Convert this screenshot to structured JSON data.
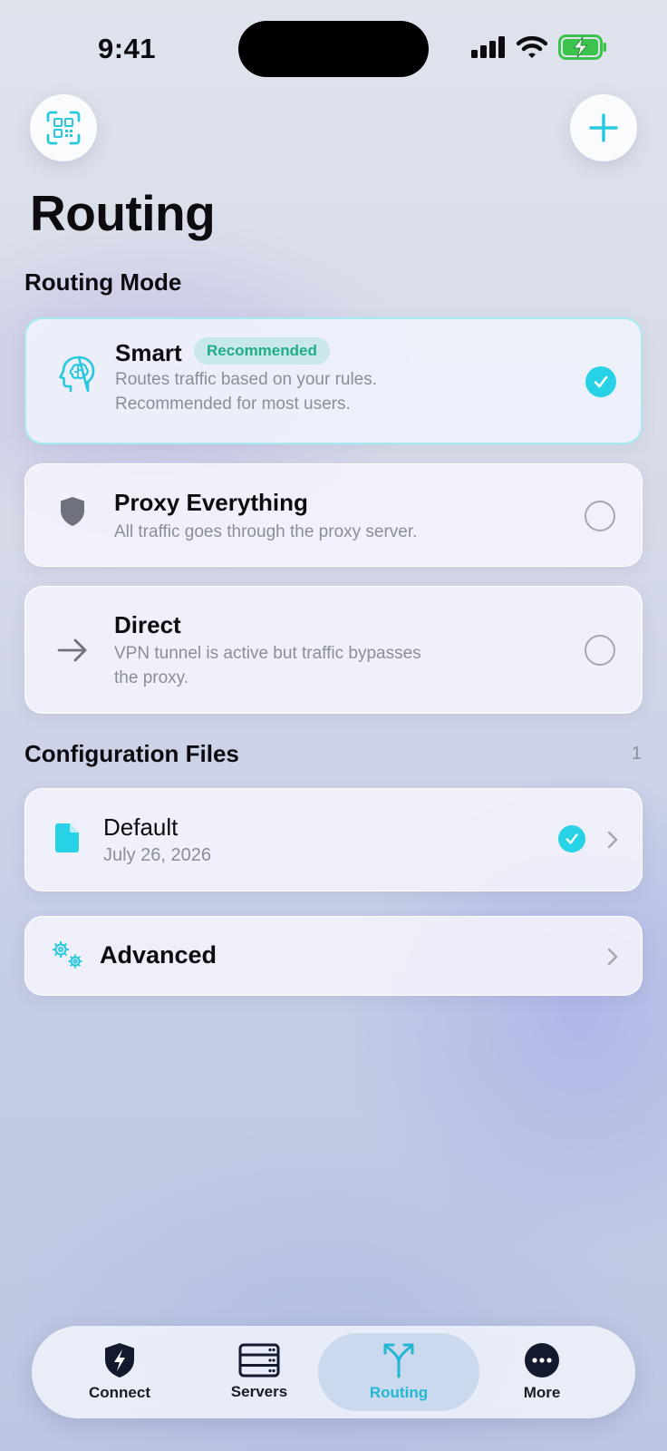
{
  "status_bar": {
    "time": "9:41"
  },
  "header": {
    "title": "Routing"
  },
  "routing_mode": {
    "section_title": "Routing Mode",
    "options": [
      {
        "name": "Smart",
        "badge": "Recommended",
        "description_line1": "Routes traffic based on your rules.",
        "description_line2": "Recommended for most users.",
        "selected": true,
        "icon": "brain-icon"
      },
      {
        "name": "Proxy Everything",
        "description_line1": "All traffic goes through the proxy server.",
        "selected": false,
        "icon": "shield-icon"
      },
      {
        "name": "Direct",
        "description_line1": "VPN tunnel is active but traffic bypasses",
        "description_line2": "the proxy.",
        "selected": false,
        "icon": "arrow-right-icon"
      }
    ]
  },
  "configuration_files": {
    "section_title": "Configuration Files",
    "count": "1",
    "files": [
      {
        "name": "Default",
        "date": "July 26, 2026",
        "selected": true,
        "icon": "document-icon"
      }
    ]
  },
  "advanced": {
    "label": "Advanced",
    "icon": "gears-icon"
  },
  "tab_bar": {
    "active": "Routing",
    "tabs": [
      {
        "label": "Connect",
        "icon": "shield-bolt-icon"
      },
      {
        "label": "Servers",
        "icon": "server-icon"
      },
      {
        "label": "Routing",
        "icon": "fork-icon"
      },
      {
        "label": "More",
        "icon": "more-icon"
      }
    ]
  },
  "colors": {
    "accent": "#28d2e6",
    "badge_text": "#1fae86",
    "secondary_text": "#8a8e98"
  }
}
